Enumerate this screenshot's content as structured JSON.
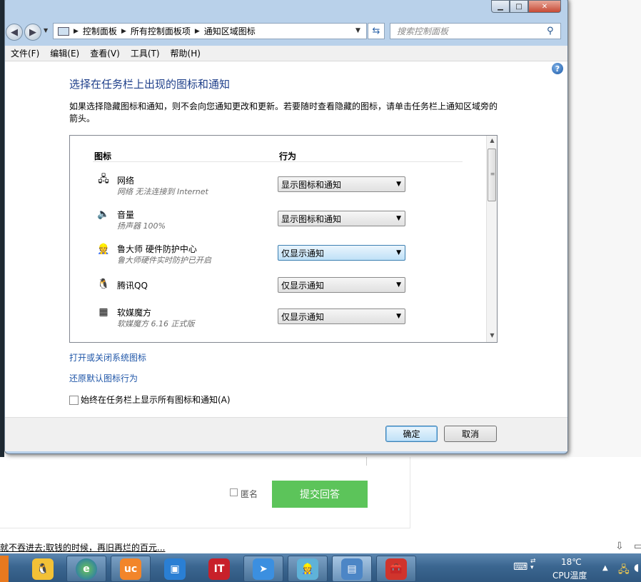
{
  "window": {
    "address": {
      "crumbs": [
        "控制面板",
        "所有控制面板项",
        "通知区域图标"
      ]
    },
    "search_placeholder": "搜索控制面板",
    "menu": [
      "文件(F)",
      "编辑(E)",
      "查看(V)",
      "工具(T)",
      "帮助(H)"
    ],
    "title": "选择在任务栏上出现的图标和通知",
    "description": "如果选择隐藏图标和通知，则不会向您通知更改和更新。若要随时查看隐藏的图标，请单击任务栏上通知区域旁的箭头。",
    "columns": {
      "icon": "图标",
      "behavior": "行为"
    },
    "rows": [
      {
        "name": "网络",
        "sub": "网络 无法连接到 Internet",
        "icon": "network-icon",
        "behavior": "显示图标和通知"
      },
      {
        "name": "音量",
        "sub": "扬声器 100%",
        "icon": "speaker-icon",
        "behavior": "显示图标和通知"
      },
      {
        "name": "鲁大师 硬件防护中心",
        "sub": "鲁大师硬件实时防护已开启",
        "icon": "ludashi-icon",
        "behavior": "仅显示通知"
      },
      {
        "name": "腾讯QQ",
        "sub": "",
        "icon": "qq-icon",
        "behavior": "仅显示通知"
      },
      {
        "name": "软媒魔方",
        "sub": "软媒魔方 6.16 正式版",
        "icon": "grid-icon",
        "behavior": "仅显示通知"
      }
    ],
    "links": {
      "system_icons": "打开或关闭系统图标",
      "restore": "还原默认图标行为"
    },
    "always_show": {
      "label": "始终在任务栏上显示所有图标和通知(A)",
      "checked": false
    },
    "buttons": {
      "ok": "确定",
      "cancel": "取消"
    }
  },
  "browser": {
    "anonymous_label": "匿名",
    "submit_label": "提交回答",
    "ticker": "就不吞进去;取钱的时候，再旧再烂的百元..."
  },
  "tray": {
    "temperature": "18℃",
    "cpu_label": "CPU温度"
  },
  "colors": {
    "link": "#1f56a8",
    "title": "#1e3f8a",
    "submit": "#5cc45a",
    "taskbar": "#3b6690"
  },
  "taskbar_apps": [
    "qq-icon",
    "browser-icon",
    "uc-browser-icon",
    "app-box-icon",
    "it-app-icon",
    "bird-app-icon",
    "ludashi-icon",
    "control-panel-icon",
    "toolbox-icon"
  ]
}
